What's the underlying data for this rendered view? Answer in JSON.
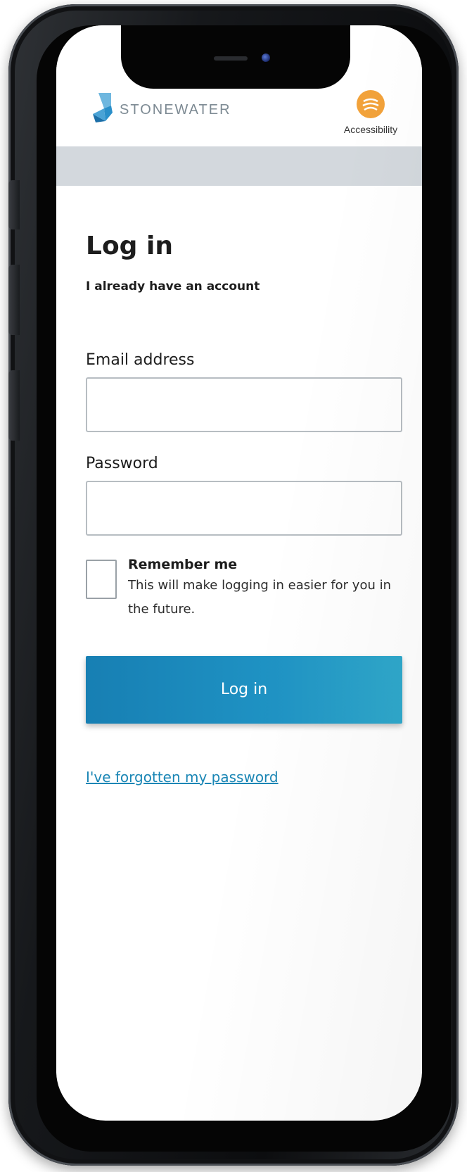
{
  "header": {
    "brand": "STONEWATER",
    "accessibility_label": "Accessibility"
  },
  "login": {
    "title": "Log in",
    "subtitle": "I already have an account",
    "email_label": "Email address",
    "email_value": "",
    "password_label": "Password",
    "password_value": "",
    "remember_checked": false,
    "remember_title": "Remember me",
    "remember_desc": "This will make logging in easier for you in the future.",
    "submit_label": "Log in",
    "forgot_link": "I've forgotten my password"
  },
  "colors": {
    "primary_button": "#1f93c4",
    "link": "#1a86b5",
    "accessibility_badge": "#f2a23a",
    "header_band": "#d3d8dd",
    "logo_blue": "#2a8fc9"
  },
  "icons": {
    "logo": "stonewater-logo-mark",
    "accessibility": "accessibility-icon"
  }
}
